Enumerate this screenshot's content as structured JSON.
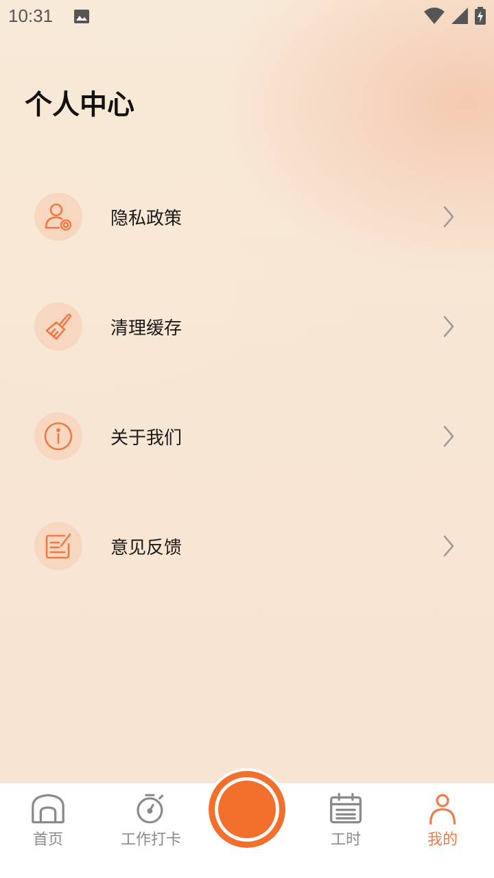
{
  "status_bar": {
    "time": "10:31"
  },
  "page_title": "个人中心",
  "menu": [
    {
      "label": "隐私政策",
      "icon": "user-settings-icon"
    },
    {
      "label": "清理缓存",
      "icon": "broom-icon"
    },
    {
      "label": "关于我们",
      "icon": "info-icon"
    },
    {
      "label": "意见反馈",
      "icon": "feedback-edit-icon"
    }
  ],
  "bottom_nav": {
    "home": "首页",
    "clock_in": "工作打卡",
    "hours": "工时",
    "mine": "我的"
  },
  "colors": {
    "accent": "#f36f2c",
    "icon_bg": "#f7d7bf",
    "active_nav": "#f07a45"
  }
}
